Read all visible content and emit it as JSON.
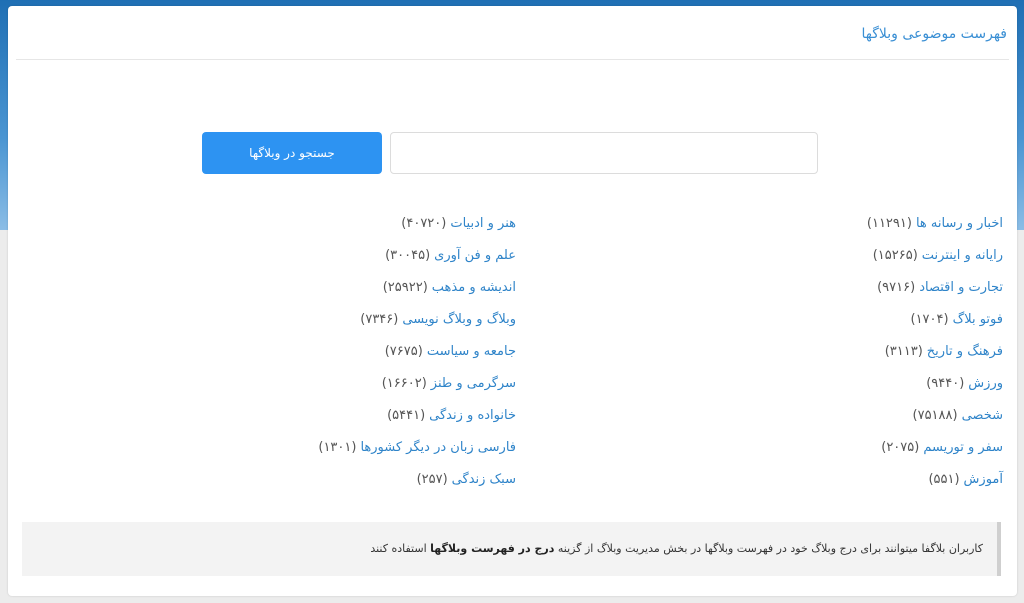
{
  "header": {
    "title": "فهرست موضوعی وبلاگها"
  },
  "search": {
    "placeholder": "",
    "value": "",
    "button_label": "جستجو در وبلاگها"
  },
  "categories": {
    "right": [
      {
        "label": "اخبار و رسانه ها",
        "count": "(۱۱۲۹۱)"
      },
      {
        "label": "رایانه و اینترنت",
        "count": "(۱۵۲۶۵)"
      },
      {
        "label": "تجارت و اقتصاد",
        "count": "(۹۷۱۶)"
      },
      {
        "label": "فوتو بلاگ",
        "count": "(۱۷۰۴)"
      },
      {
        "label": "فرهنگ و تاریخ",
        "count": "(۳۱۱۳)"
      },
      {
        "label": "ورزش",
        "count": "(۹۴۴۰)"
      },
      {
        "label": "شخصی",
        "count": "(۷۵۱۸۸)"
      },
      {
        "label": "سفر و توریسم",
        "count": "(۲۰۷۵)"
      },
      {
        "label": "آموزش",
        "count": "(۵۵۱)"
      }
    ],
    "left": [
      {
        "label": "هنر و ادبیات",
        "count": "(۴۰۷۲۰)"
      },
      {
        "label": "علم و فن آوری",
        "count": "(۳۰۰۴۵)"
      },
      {
        "label": "اندیشه و مذهب",
        "count": "(۲۵۹۲۲)"
      },
      {
        "label": "وبلاگ و وبلاگ نویسی",
        "count": "(۷۳۴۶)"
      },
      {
        "label": "جامعه و سیاست",
        "count": "(۷۶۷۵)"
      },
      {
        "label": "سرگرمی و طنز",
        "count": "(۱۶۶۰۲)"
      },
      {
        "label": "خانواده و زندگی",
        "count": "(۵۴۴۱)"
      },
      {
        "label": "فارسی زبان در دیگر کشورها",
        "count": "(۱۳۰۱)"
      },
      {
        "label": "سبک زندگی",
        "count": "(۲۵۷)"
      }
    ]
  },
  "info": {
    "text_before": "کاربران بلاگفا میتوانند برای درج وبلاگ خود در فهرست وبلاگها در بخش مدیریت وبلاگ از گزینه",
    "bold": "درج در فهرست وبلاگها",
    "text_after": "استفاده کنند"
  }
}
